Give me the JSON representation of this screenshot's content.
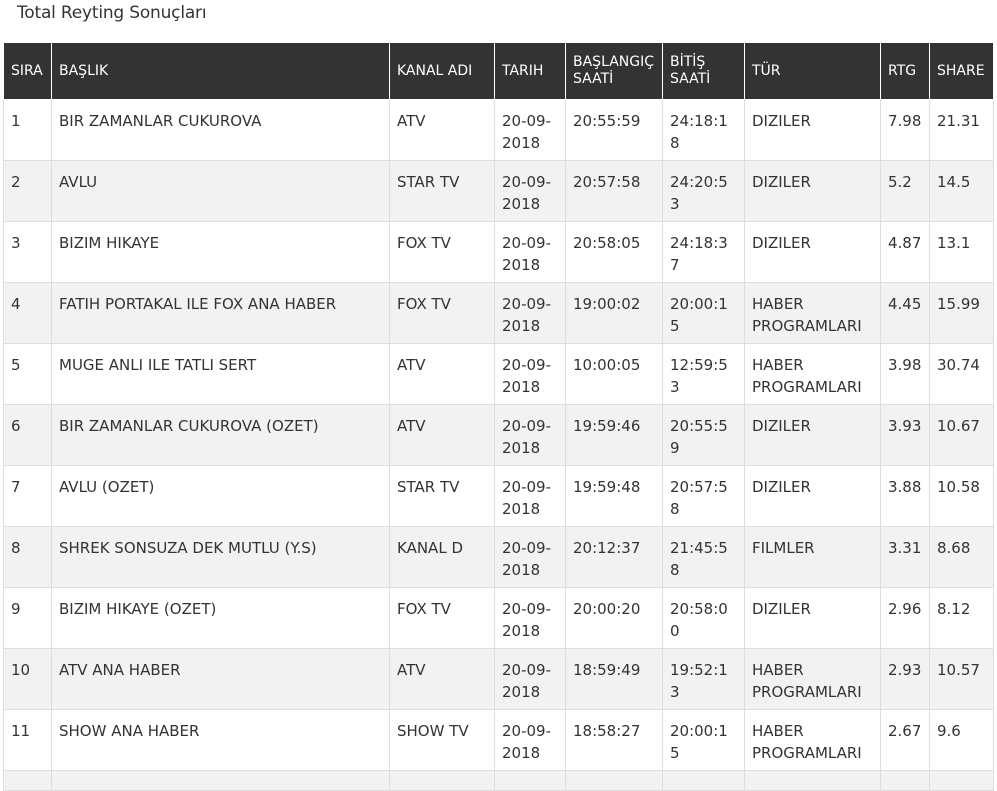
{
  "page": {
    "title": "Total Reyting Sonuçları"
  },
  "table": {
    "headers": {
      "sira": "SIRA",
      "baslik": "BAŞLIK",
      "kanal": "KANAL ADI",
      "tarih": "TARIH",
      "baslangic": "BAŞLANGIÇ SAATİ",
      "bitis": "BİTİŞ SAATİ",
      "tur": "TÜR",
      "rtg": "RTG",
      "share": "SHARE"
    },
    "rows": [
      {
        "sira": "1",
        "baslik": "BIR ZAMANLAR CUKUROVA",
        "kanal": "ATV",
        "tarih": "20-09-2018",
        "baslangic": "20:55:59",
        "bitis": "24:18:18",
        "tur": "DIZILER",
        "rtg": "7.98",
        "share": "21.31"
      },
      {
        "sira": "2",
        "baslik": "AVLU",
        "kanal": "STAR TV",
        "tarih": "20-09-2018",
        "baslangic": "20:57:58",
        "bitis": "24:20:53",
        "tur": "DIZILER",
        "rtg": "5.2",
        "share": "14.5"
      },
      {
        "sira": "3",
        "baslik": "BIZIM HIKAYE",
        "kanal": "FOX TV",
        "tarih": "20-09-2018",
        "baslangic": "20:58:05",
        "bitis": "24:18:37",
        "tur": "DIZILER",
        "rtg": "4.87",
        "share": "13.1"
      },
      {
        "sira": "4",
        "baslik": "FATIH PORTAKAL ILE FOX ANA HABER",
        "kanal": "FOX TV",
        "tarih": "20-09-2018",
        "baslangic": "19:00:02",
        "bitis": "20:00:15",
        "tur": "HABER PROGRAMLARI",
        "rtg": "4.45",
        "share": "15.99"
      },
      {
        "sira": "5",
        "baslik": "MUGE ANLI ILE TATLI SERT",
        "kanal": "ATV",
        "tarih": "20-09-2018",
        "baslangic": "10:00:05",
        "bitis": "12:59:53",
        "tur": "HABER PROGRAMLARI",
        "rtg": "3.98",
        "share": "30.74"
      },
      {
        "sira": "6",
        "baslik": "BIR ZAMANLAR CUKUROVA (OZET)",
        "kanal": "ATV",
        "tarih": "20-09-2018",
        "baslangic": "19:59:46",
        "bitis": "20:55:59",
        "tur": "DIZILER",
        "rtg": "3.93",
        "share": "10.67"
      },
      {
        "sira": "7",
        "baslik": "AVLU (OZET)",
        "kanal": "STAR TV",
        "tarih": "20-09-2018",
        "baslangic": "19:59:48",
        "bitis": "20:57:58",
        "tur": "DIZILER",
        "rtg": "3.88",
        "share": "10.58"
      },
      {
        "sira": "8",
        "baslik": "SHREK SONSUZA DEK MUTLU (Y.S)",
        "kanal": "KANAL D",
        "tarih": "20-09-2018",
        "baslangic": "20:12:37",
        "bitis": "21:45:58",
        "tur": "FILMLER",
        "rtg": "3.31",
        "share": "8.68"
      },
      {
        "sira": "9",
        "baslik": "BIZIM HIKAYE (OZET)",
        "kanal": "FOX TV",
        "tarih": "20-09-2018",
        "baslangic": "20:00:20",
        "bitis": "20:58:00",
        "tur": "DIZILER",
        "rtg": "2.96",
        "share": "8.12"
      },
      {
        "sira": "10",
        "baslik": "ATV ANA HABER",
        "kanal": "ATV",
        "tarih": "20-09-2018",
        "baslangic": "18:59:49",
        "bitis": "19:52:13",
        "tur": "HABER PROGRAMLARI",
        "rtg": "2.93",
        "share": "10.57"
      },
      {
        "sira": "11",
        "baslik": "SHOW ANA HABER",
        "kanal": "SHOW TV",
        "tarih": "20-09-2018",
        "baslangic": "18:58:27",
        "bitis": "20:00:15",
        "tur": "HABER PROGRAMLARI",
        "rtg": "2.67",
        "share": "9.6"
      }
    ]
  }
}
